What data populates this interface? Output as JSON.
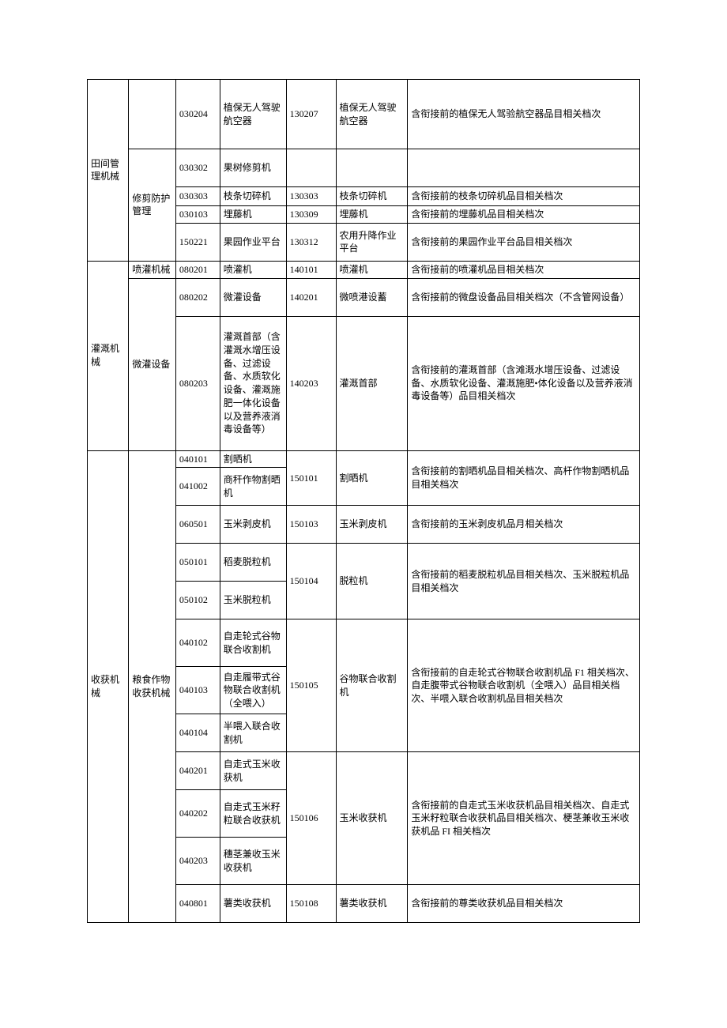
{
  "table": {
    "group1": {
      "label": "田间管理机械"
    },
    "r030204": {
      "code": "030204",
      "name": "植保无人驾驶航空器",
      "code2": "130207",
      "name2": "植保无人驾驶航空器",
      "remark": "含衔接前的植保无人驾验航空器品目相关档次"
    },
    "subgroup_trim": {
      "label": "修剪防护管理"
    },
    "r030302": {
      "code": "030302",
      "name": "果树修剪机",
      "code2": "",
      "name2": "",
      "remark": ""
    },
    "r030303": {
      "code": "030303",
      "name": "枝条切碎机",
      "code2": "130303",
      "name2": "枝条切碎机",
      "remark": "含衔接前的枝条切碎机品目相关档次"
    },
    "r030103": {
      "code": "030103",
      "name": "埋藤机",
      "code2": "130309",
      "name2": "埋藤机",
      "remark": "含衔接前的埋藤机品目相关档次"
    },
    "r150221": {
      "code": "150221",
      "name": "果园作业平台",
      "code2": "130312",
      "name2": "农用升降作业平台",
      "remark": "含衔接前的果园作业平台品目相关档次"
    },
    "group2": {
      "label": "灌溉机械"
    },
    "subgroup_spray": {
      "label": "喷灌机械"
    },
    "r080201": {
      "code": "080201",
      "name": "喷灌机",
      "code2": "140101",
      "name2": "喷灌机",
      "remark": "含衔接前的喷灌机品目相关档次"
    },
    "subgroup_micro": {
      "label": "微灌设备"
    },
    "r080202": {
      "code": "080202",
      "name": "微灌设备",
      "code2": "140201",
      "name2": "微喷港设蓄",
      "remark": "含衔接前的微盘设备品目相关档次（不含管网设备）"
    },
    "r080203": {
      "code": "080203",
      "name": "灌溉首部（含灌溉水增压设备、过滤设备、水质软化设备、灌溉施肥一体化设备以及营养液消毒设备等）",
      "code2": "140203",
      "name2": "灌溉首部",
      "remark": "含衔接前的灌溉首部（含滩溉水增压设备、过滤设备、水质软化设备、灌溉施肥•体化设备以及营养液消毒设备等）品目相关档次"
    },
    "group3": {
      "label": "收获机械"
    },
    "subgroup_grain": {
      "label": "粮食作物收获机械"
    },
    "r040101": {
      "code": "040101",
      "name": "割晒机"
    },
    "r041002": {
      "code": "041002",
      "name": "商秆作物割晒机"
    },
    "cut_merge": {
      "code2": "150101",
      "name2": "割晒机",
      "remark": "含衔接前的割晒机品目相关档次、高杆作物割晒机品目相关档次"
    },
    "r060501": {
      "code": "060501",
      "name": "玉米剥皮机",
      "code2": "150103",
      "name2": "玉米剥皮机",
      "remark": "含衔接前的玉米剥皮机品月相关档次"
    },
    "r050101": {
      "code": "050101",
      "name": "稻麦脱粒机"
    },
    "r050102": {
      "code": "050102",
      "name": "玉米脱粒机"
    },
    "thresh_merge": {
      "code2": "150104",
      "name2": "脱粒机",
      "remark": "含衔接前的稻麦脱粒机品目相关档次、玉米脱粒机品目相关档次"
    },
    "r040102": {
      "code": "040102",
      "name": "自走轮式谷物联合收割机"
    },
    "r040103": {
      "code": "040103",
      "name": "自走履带式谷物联合收割机（全喂入）"
    },
    "r040104": {
      "code": "040104",
      "name": "半喂入联合收割机"
    },
    "grain_merge": {
      "code2": "150105",
      "name2": "谷物联合收割机",
      "remark": "含衔接前的自走轮式谷物联合收割机品 F1 相关档次、自走腹带式谷物联合收割机（全喂入）品目相关档次、半喂入联合收割机品目相关档次"
    },
    "r040201": {
      "code": "040201",
      "name": "自走式玉米收获机"
    },
    "r040202": {
      "code": "040202",
      "name": "自走式玉米籽粒联合收获机"
    },
    "r040203": {
      "code": "040203",
      "name": "穗茎兼收玉米收获机"
    },
    "corn_merge": {
      "code2": "150106",
      "name2": "玉米收获机",
      "remark": "含衔接前的自走式玉米收获机品目相关档次、自走式玉米籽粒联合收获机品目相关档次、梗茎兼收玉米收获机品 FI 相关档次"
    },
    "r040801": {
      "code": "040801",
      "name": "薯类收获机",
      "code2": "150108",
      "name2": "薯类收获机",
      "remark": "含衔接前的尊类收获机品目相关档次"
    }
  }
}
